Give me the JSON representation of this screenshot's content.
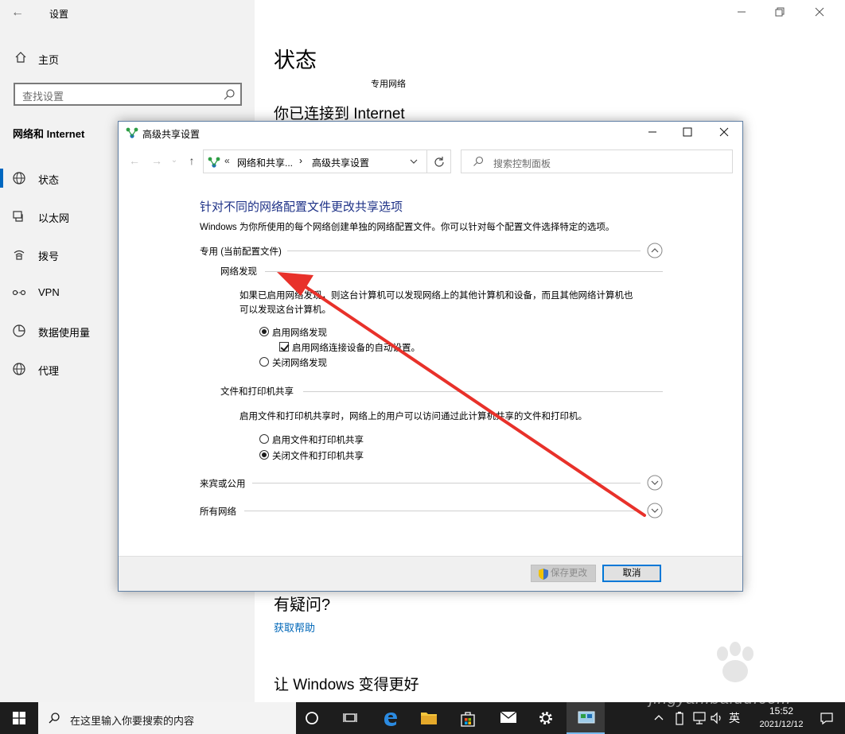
{
  "settings": {
    "title": "设置",
    "home": "主页",
    "search_placeholder": "查找设置",
    "section": "网络和 Internet",
    "nav": [
      {
        "label": "状态",
        "icon": "globe-icon"
      },
      {
        "label": "以太网",
        "icon": "ethernet-icon"
      },
      {
        "label": "拨号",
        "icon": "dialup-icon"
      },
      {
        "label": "VPN",
        "icon": "vpn-icon"
      },
      {
        "label": "数据使用量",
        "icon": "data-usage-icon"
      },
      {
        "label": "代理",
        "icon": "proxy-globe-icon"
      }
    ],
    "active_index": 0
  },
  "content": {
    "status_heading": "状态",
    "network_name": "专用网络",
    "connected_heading": "你已连接到 Internet",
    "question_heading": "有疑问?",
    "get_help": "获取帮助",
    "improve_heading": "让 Windows 变得更好"
  },
  "dialog": {
    "title": "高级共享设置",
    "address": {
      "sep": "«",
      "crumb1": "网络和共享...",
      "arrow": "›",
      "crumb2": "高级共享设置"
    },
    "search_placeholder": "搜索控制面板",
    "heading": "针对不同的网络配置文件更改共享选项",
    "description": "Windows 为你所使用的每个网络创建单独的网络配置文件。你可以针对每个配置文件选择特定的选项。",
    "profile_private": "专用 (当前配置文件)",
    "network_discovery": {
      "title": "网络发现",
      "para_line1": "如果已启用网络发现，则这台计算机可以发现网络上的其他计算机和设备，而且其他网络计算机也",
      "para_line2": "可以发现这台计算机。",
      "opt_on": "启用网络发现",
      "auto_setup": "启用网络连接设备的自动设置。",
      "opt_off": "关闭网络发现"
    },
    "file_sharing": {
      "title": "文件和打印机共享",
      "para": "启用文件和打印机共享时，网络上的用户可以访问通过此计算机共享的文件和打印机。",
      "opt_on": "启用文件和打印机共享",
      "opt_off": "关闭文件和打印机共享"
    },
    "profile_guest": "来宾或公用",
    "profile_all": "所有网络",
    "save_label": "保存更改",
    "cancel_label": "取消"
  },
  "taskbar": {
    "search_placeholder": "在这里输入你要搜索的内容",
    "ime": "英",
    "time": "15:52",
    "date": "2021/12/12"
  },
  "watermark": "jingyan.baidu.com",
  "colors": {
    "accent": "#0067c0",
    "link": "#0067b8",
    "dialog_heading": "#1e3287",
    "annotation_arrow": "#e8312a"
  }
}
